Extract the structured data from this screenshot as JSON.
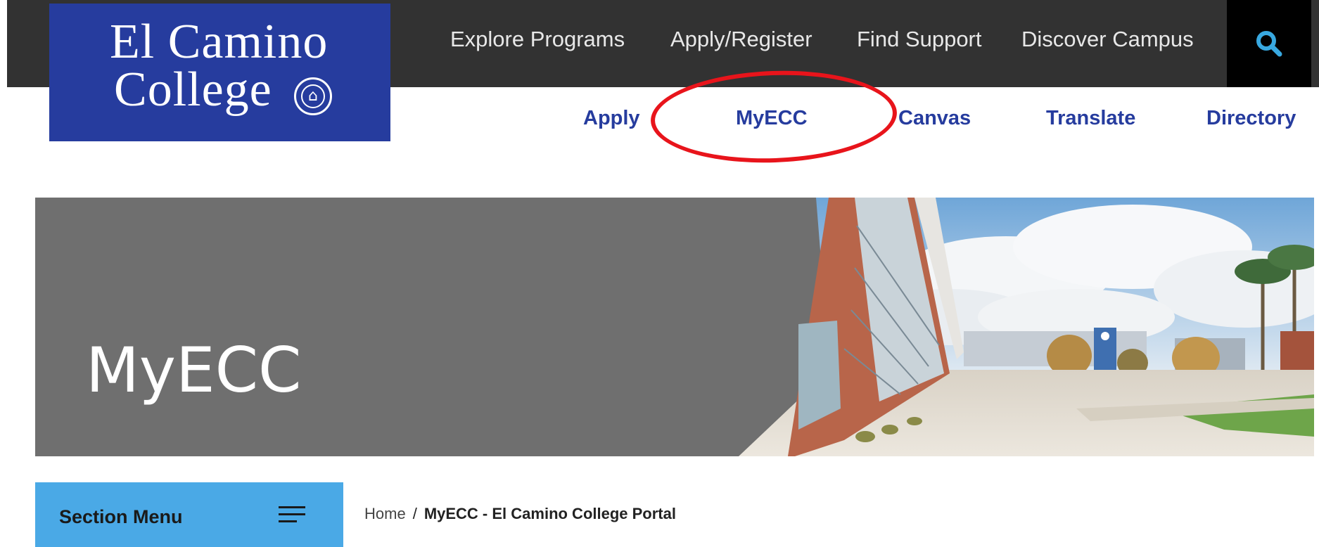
{
  "logo": {
    "line1": "El Camino",
    "line2": "College"
  },
  "main_nav": [
    {
      "label": "Explore Programs"
    },
    {
      "label": "Apply/Register"
    },
    {
      "label": "Find Support"
    },
    {
      "label": "Discover Campus"
    }
  ],
  "utility_nav": [
    {
      "label": "Apply"
    },
    {
      "label": "MyECC"
    },
    {
      "label": "Canvas"
    },
    {
      "label": "Translate"
    },
    {
      "label": "Directory"
    }
  ],
  "hero": {
    "title": "MyECC"
  },
  "section_menu": {
    "label": "Section Menu"
  },
  "breadcrumb": {
    "home": "Home",
    "separator": "/",
    "current": "MyECC - El Camino College Portal"
  },
  "colors": {
    "brand_blue": "#263c9e",
    "topbar": "#323232",
    "search_accent": "#38a8e0",
    "section_menu_bg": "#4aa9e6",
    "highlight": "#e8141b",
    "hero_gray": "#6f6f6f"
  },
  "icons": {
    "search": "search-icon",
    "menu": "hamburger-menu-icon",
    "seal": "college-seal-icon"
  }
}
